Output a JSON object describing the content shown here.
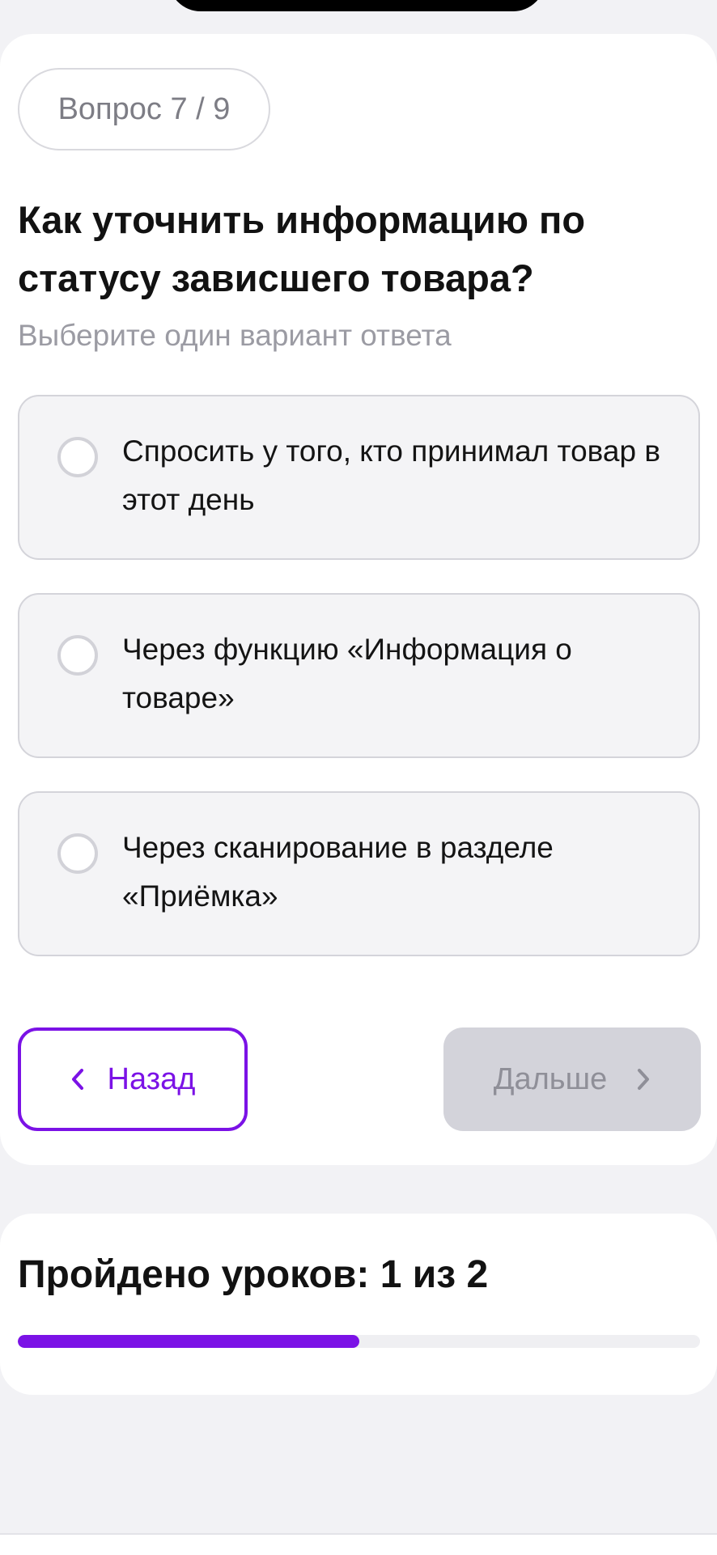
{
  "quiz": {
    "counter": "Вопрос 7 / 9",
    "question": "Как уточнить информацию по статусу зависшего товара?",
    "hint": "Выберите один вариант ответа",
    "options": [
      {
        "label": "Спросить у того, кто принимал товар в этот день",
        "selected": false
      },
      {
        "label": "Через функцию «Информация о товаре»",
        "selected": false
      },
      {
        "label": "Через сканирование в разделе «Приёмка»",
        "selected": false
      }
    ],
    "back_label": "Назад",
    "next_label": "Дальше",
    "next_enabled": false
  },
  "progress": {
    "label": "Пройдено уроков: 1 из 2",
    "completed": 1,
    "total": 2
  },
  "icons": {
    "back": "chevron-left-icon",
    "next": "chevron-right-icon"
  },
  "colors": {
    "accent": "#7b12e6",
    "disabled_button": "#d3d3da",
    "option_background": "#f4f4f6"
  }
}
